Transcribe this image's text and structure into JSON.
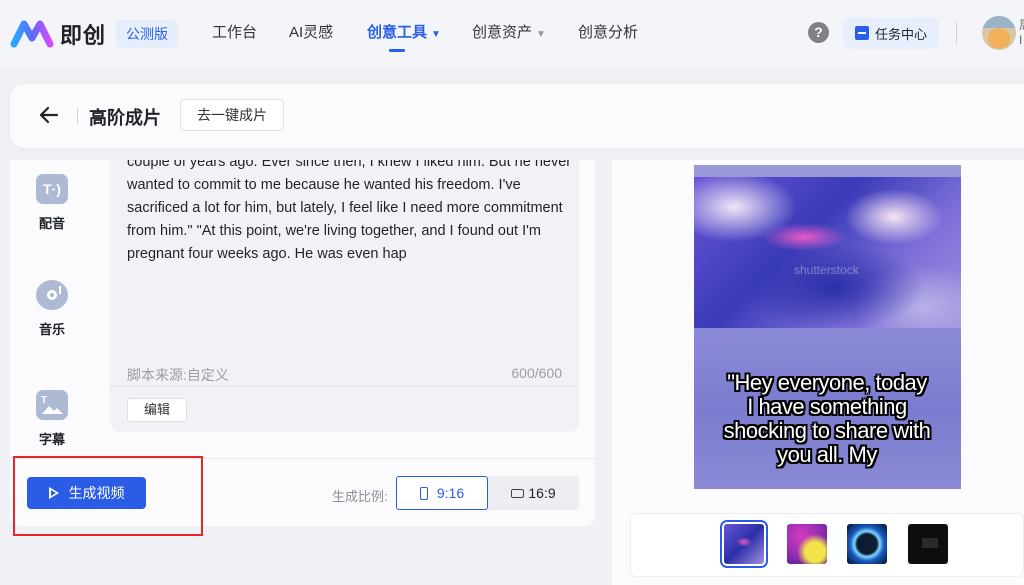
{
  "app": {
    "logo_text": "即创",
    "beta_badge": "公测版"
  },
  "nav": {
    "items": [
      {
        "label": "工作台"
      },
      {
        "label": "AI灵感"
      },
      {
        "label": "创意工具"
      },
      {
        "label": "创意资产"
      },
      {
        "label": "创意分析"
      }
    ],
    "active": "创意工具",
    "help_symbol": "?",
    "task_center": "任务中心",
    "user_name_partial": "周\nI"
  },
  "header": {
    "title": "高阶成片",
    "one_click_button": "去一键成片"
  },
  "tools": [
    {
      "label": "配音",
      "icon": "tts-icon"
    },
    {
      "label": "音乐",
      "icon": "music-disc-icon"
    },
    {
      "label": "字幕",
      "icon": "subtitle-icon"
    }
  ],
  "script": {
    "text": "couple of years ago. Ever since then, I knew I liked him. But he never wanted to commit to me because he wanted his freedom. I've sacrificed a lot for him, but lately, I feel like I need more commitment from him.\" \"At this point, we're living together, and I found out I'm pregnant four weeks ago. He was even hap",
    "source": "脚本来源:自定义",
    "count": "600/600",
    "edit_button": "编辑"
  },
  "generate": {
    "button": "生成视频",
    "ratio_label": "生成比例:",
    "ratio_options": [
      {
        "label": "9:16",
        "selected": true
      },
      {
        "label": "16:9",
        "selected": false
      }
    ]
  },
  "preview": {
    "caption": "\"Hey everyone, today I have something shocking to share with you all. My",
    "watermark": "shutterstock",
    "thumbnails": [
      {
        "name": "purple-fluid",
        "selected": true
      },
      {
        "name": "magenta-yellow-abstract",
        "selected": false
      },
      {
        "name": "blue-glow-circle",
        "selected": false
      },
      {
        "name": "dark-clip",
        "selected": false
      }
    ]
  },
  "colors": {
    "accent": "#2b5ce6",
    "highlight_box": "#e8262a"
  }
}
